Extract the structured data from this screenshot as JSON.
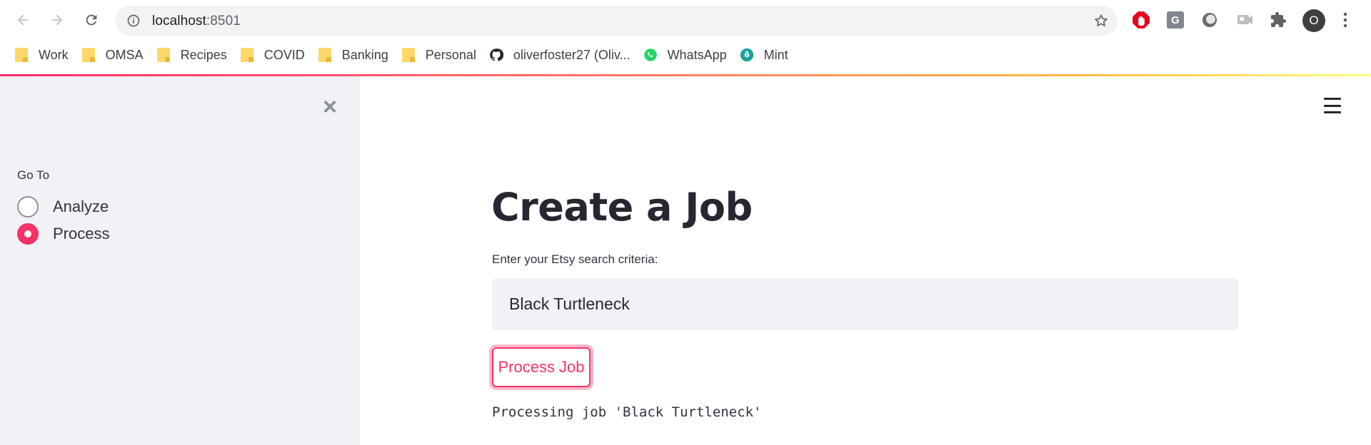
{
  "browser": {
    "url_host": "localhost",
    "url_port": ":8501",
    "avatar_initial": "O",
    "bookmarks": [
      {
        "label": "Work",
        "icon": "folder-icon"
      },
      {
        "label": "OMSA",
        "icon": "folder-icon"
      },
      {
        "label": "Recipes",
        "icon": "folder-icon"
      },
      {
        "label": "COVID",
        "icon": "folder-icon"
      },
      {
        "label": "Banking",
        "icon": "folder-icon"
      },
      {
        "label": "Personal",
        "icon": "folder-icon"
      },
      {
        "label": "oliverfoster27 (Oliv...",
        "icon": "github-icon"
      },
      {
        "label": "WhatsApp",
        "icon": "whatsapp-icon"
      },
      {
        "label": "Mint",
        "icon": "mint-icon"
      }
    ],
    "extensions": [
      {
        "name": "adblock-icon",
        "text": ""
      },
      {
        "name": "g-extension-icon",
        "text": "G"
      },
      {
        "name": "circle-extension-icon",
        "text": ""
      },
      {
        "name": "cast-extension-icon",
        "text": ""
      },
      {
        "name": "puzzle-icon",
        "text": ""
      }
    ]
  },
  "sidebar": {
    "close_glyph": "×",
    "goto_label": "Go To",
    "options": [
      {
        "label": "Analyze",
        "selected": false
      },
      {
        "label": "Process",
        "selected": true
      }
    ]
  },
  "main": {
    "title": "Create a Job",
    "input_label": "Enter your Etsy search criteria:",
    "input_value": "Black Turtleneck",
    "button_label": "Process Job",
    "output_text": "Processing job 'Black Turtleneck'"
  },
  "colors": {
    "accent": "#f63366",
    "sidebar_bg": "#f0f2f6",
    "text": "#262730"
  }
}
